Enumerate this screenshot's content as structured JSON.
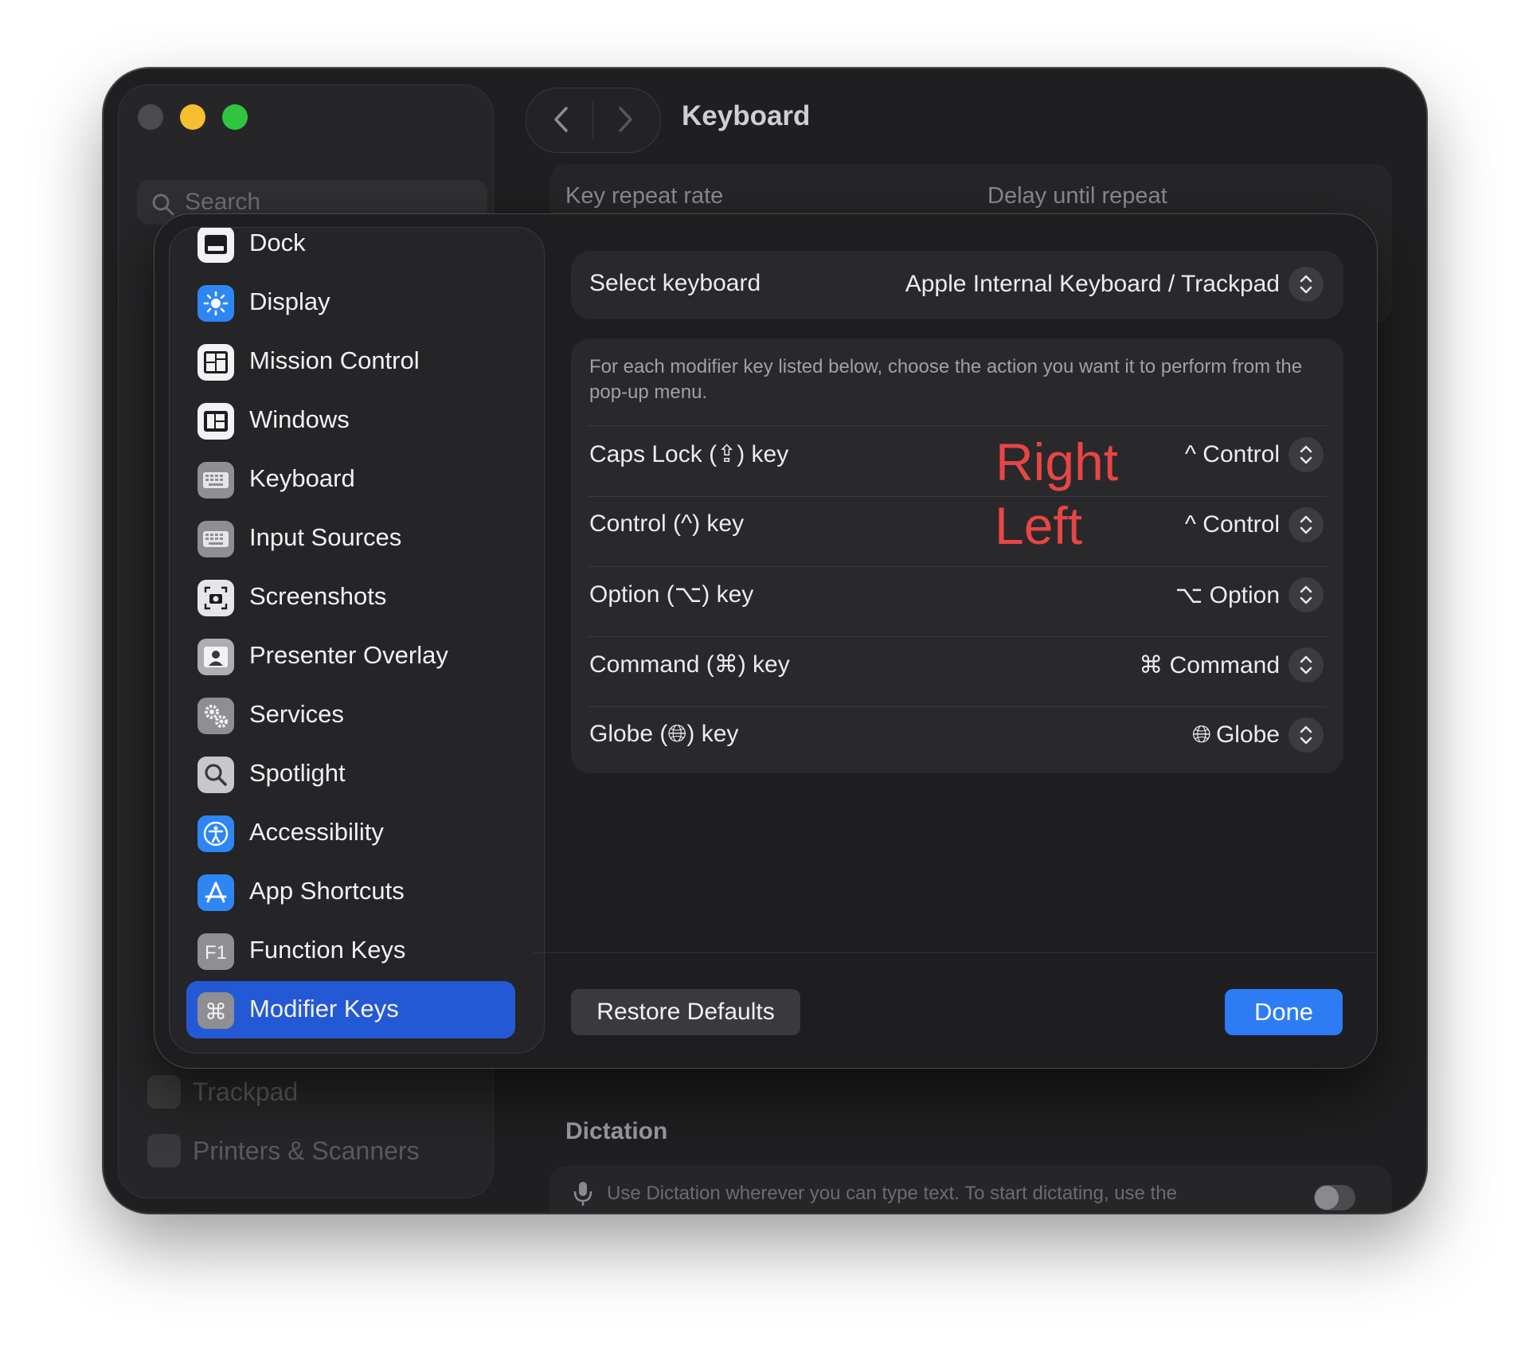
{
  "window": {
    "title": "Keyboard",
    "traffic_colors": [
      "#4b4b4d",
      "#f5bf2f",
      "#2fc541"
    ]
  },
  "background": {
    "search_placeholder": "Search",
    "key_repeat_label": "Key repeat rate",
    "delay_label": "Delay until repeat",
    "dimmed_items": [
      "Trackpad",
      "Printers & Scanners"
    ],
    "dictation_title": "Dictation",
    "dictation_text": "Use Dictation wherever you can type text. To start dictating, use the"
  },
  "sidebar": {
    "items": [
      {
        "label": "Dock",
        "icon": "dock-icon"
      },
      {
        "label": "Display",
        "icon": "display-icon"
      },
      {
        "label": "Mission Control",
        "icon": "mission-control-icon"
      },
      {
        "label": "Windows",
        "icon": "windows-icon"
      },
      {
        "label": "Keyboard",
        "icon": "keyboard-icon"
      },
      {
        "label": "Input Sources",
        "icon": "input-sources-icon"
      },
      {
        "label": "Screenshots",
        "icon": "screenshots-icon"
      },
      {
        "label": "Presenter Overlay",
        "icon": "presenter-overlay-icon"
      },
      {
        "label": "Services",
        "icon": "services-icon"
      },
      {
        "label": "Spotlight",
        "icon": "spotlight-icon"
      },
      {
        "label": "Accessibility",
        "icon": "accessibility-icon"
      },
      {
        "label": "App Shortcuts",
        "icon": "app-shortcuts-icon"
      },
      {
        "label": "Function Keys",
        "icon": "function-keys-icon"
      },
      {
        "label": "Modifier Keys",
        "icon": "modifier-keys-icon",
        "selected": true
      }
    ]
  },
  "select_keyboard": {
    "label": "Select keyboard",
    "value": "Apple Internal Keyboard / Trackpad"
  },
  "modifiers": {
    "description": "For each modifier key listed below, choose the action you want it to perform from the pop-up menu.",
    "rows": [
      {
        "label": "Caps Lock (⇪) key",
        "value": "^ Control"
      },
      {
        "label": "Control (^) key",
        "value": "^ Control"
      },
      {
        "label": "Option (⌥) key",
        "value": "⌥ Option"
      },
      {
        "label": "Command (⌘) key",
        "value": "⌘ Command"
      },
      {
        "label": "Globe (🌐︎) key",
        "value": "Globe"
      }
    ],
    "globe_glyph": "🌐︎"
  },
  "annotations": {
    "right": "Right",
    "left": "Left",
    "color": "#e84545"
  },
  "buttons": {
    "restore": "Restore Defaults",
    "done": "Done"
  },
  "colors": {
    "accent": "#2d7cf6",
    "selection": "#2459d6"
  }
}
